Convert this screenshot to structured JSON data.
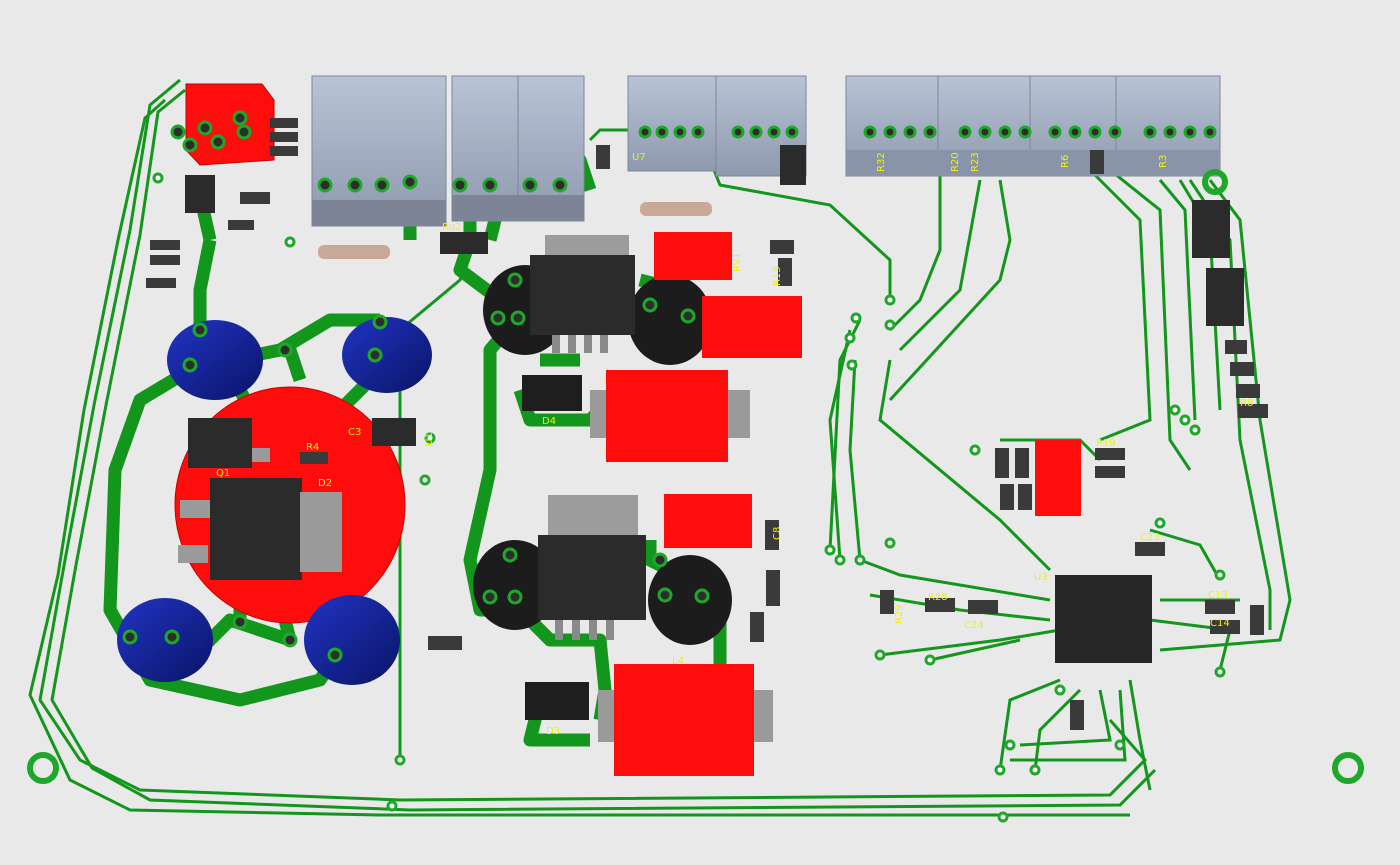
{
  "colors": {
    "board": "#ececec",
    "trace": "#13961c",
    "pad": "#1ea82a",
    "silkscreen": "#f2f200",
    "red_part": "#ff0d0d",
    "ic_body": "#2b2b2b",
    "cap_blue": "#0d1a8a",
    "cap_black": "#1c1c1c",
    "gray_block": "#a3aec4"
  },
  "labels": {
    "q1": "Q1",
    "d2": "D2",
    "r4": "R4",
    "c3": "C3",
    "u1": "U1",
    "ru2": "Ru2",
    "rv1": "RV1",
    "r13": "R13",
    "r32": "R32",
    "r20": "R20",
    "r23": "R23",
    "r6": "R6",
    "r3": "R3",
    "u3": "U3",
    "u7": "U7",
    "d3": "D3",
    "d4": "D4",
    "l4": "L4",
    "c8": "C8",
    "r29": "R29",
    "r28": "R28",
    "c24": "C24",
    "c23": "C23",
    "c13": "C13",
    "c14": "C14",
    "r19": "R19",
    "r8": "R8"
  }
}
